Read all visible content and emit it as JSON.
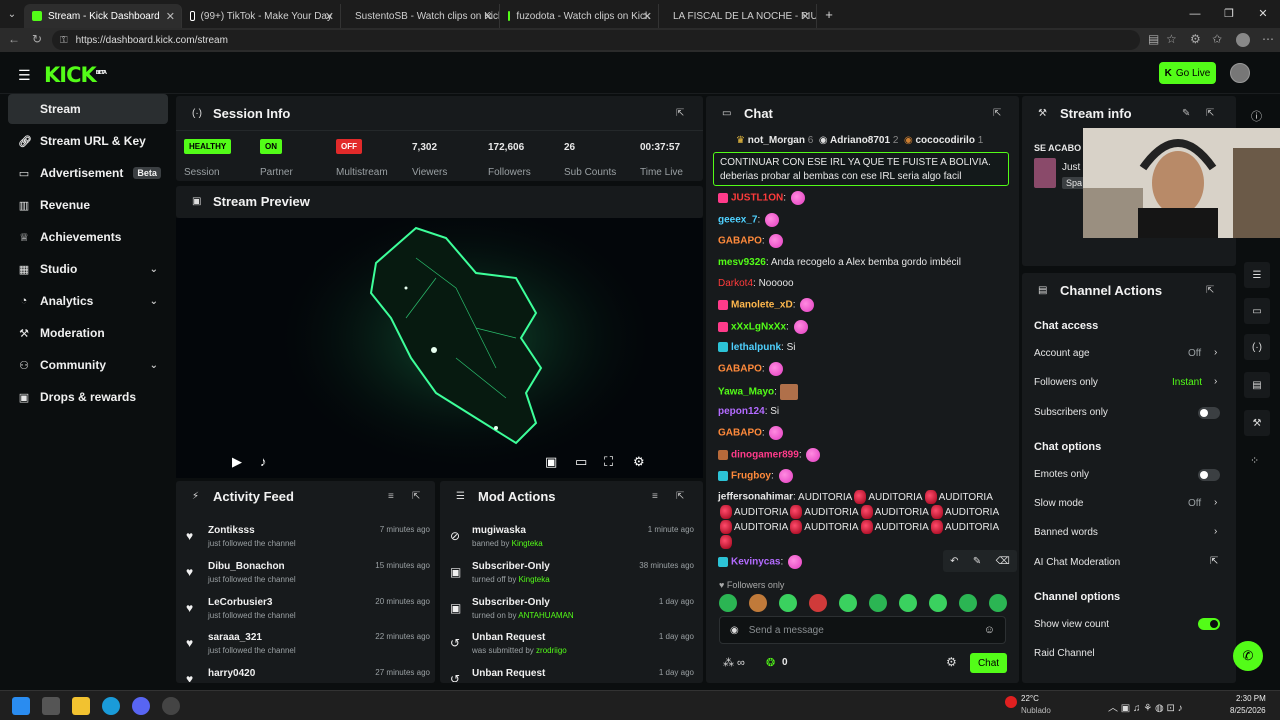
{
  "browser": {
    "tabs": [
      {
        "title": "Stream - Kick Dashboard",
        "active": true,
        "icon": "kick-icon"
      },
      {
        "title": "(99+) TikTok - Make Your Day",
        "active": false,
        "icon": "tiktok-icon"
      },
      {
        "title": "SustentoSB - Watch clips on Kick",
        "active": false,
        "icon": "kick-icon"
      },
      {
        "title": "fuzodota - Watch clips on Kick",
        "active": false,
        "icon": "kick-icon"
      },
      {
        "title": "LA FISCAL DE LA NOCHE - PIURA",
        "active": false,
        "icon": "youtube-icon"
      }
    ],
    "url": "https://dashboard.kick.com/stream"
  },
  "header": {
    "logo": "KICK",
    "logo_sup": "BETA",
    "go_live": "Go Live"
  },
  "sidebar": {
    "items": [
      {
        "label": "Stream",
        "icon": "broadcast-icon"
      },
      {
        "label": "Stream URL & Key",
        "icon": "link-icon"
      },
      {
        "label": "Advertisement",
        "badge": "Beta",
        "icon": "tv-icon"
      },
      {
        "label": "Revenue",
        "icon": "chart-icon"
      },
      {
        "label": "Achievements",
        "icon": "trophy-icon"
      },
      {
        "label": "Studio",
        "icon": "grid-icon"
      },
      {
        "label": "Analytics",
        "icon": "analytics-icon"
      },
      {
        "label": "Moderation",
        "icon": "wrench-icon"
      },
      {
        "label": "Community",
        "icon": "users-icon"
      },
      {
        "label": "Drops & rewards",
        "icon": "gift-icon"
      }
    ]
  },
  "session": {
    "title": "Session Info",
    "healthy": "HEALTHY",
    "session_label": "Session",
    "partner_badge": "ON",
    "partner_label": "Partner",
    "multistream_badge": "OFF",
    "multistream_label": "Multistream",
    "viewers": "7,302",
    "viewers_label": "Viewers",
    "followers": "172,606",
    "followers_label": "Followers",
    "subs": "26",
    "subs_label": "Sub Counts",
    "time": "00:37:57",
    "time_label": "Time Live"
  },
  "preview": {
    "title": "Stream Preview"
  },
  "activity": {
    "title": "Activity Feed",
    "items": [
      {
        "name": "Zontiksss",
        "sub": "just followed the channel",
        "time": "7 minutes ago"
      },
      {
        "name": "Dibu_Bonachon",
        "sub": "just followed the channel",
        "time": "15 minutes ago"
      },
      {
        "name": "LeCorbusier3",
        "sub": "just followed the channel",
        "time": "20 minutes ago"
      },
      {
        "name": "saraaa_321",
        "sub": "just followed the channel",
        "time": "22 minutes ago"
      },
      {
        "name": "harry0420",
        "sub": "",
        "time": "27 minutes ago"
      }
    ]
  },
  "mod": {
    "title": "Mod Actions",
    "items": [
      {
        "name": "mugiwaska",
        "sub": "banned by",
        "by": "Kingteka",
        "time": "1 minute ago"
      },
      {
        "name": "Subscriber-Only",
        "sub": "turned off by",
        "by": "Kingteka",
        "time": "38 minutes ago"
      },
      {
        "name": "Subscriber-Only",
        "sub": "turned on by",
        "by": "ANTAHUAMAN",
        "time": "1 day ago"
      },
      {
        "name": "Unban Request",
        "sub": "was submitted by",
        "by": "zrodriigo",
        "time": "1 day ago"
      },
      {
        "name": "Unban Request",
        "sub": "",
        "by": "",
        "time": "1 day ago"
      }
    ]
  },
  "chat": {
    "title": "Chat",
    "top_gifters": [
      {
        "name": "not_Morgan",
        "count": "6"
      },
      {
        "name": "Adriano8701",
        "count": "2"
      },
      {
        "name": "cococodirilo",
        "count": "1"
      }
    ],
    "pinned": "CONTINUAR CON ESE IRL YA QUE TE FUISTE A BOLIVIA. deberias probar al bembas con ese IRL seria algo facil",
    "messages": [
      {
        "user": "JUSTL1ON",
        "color": "#ff3b3b",
        "text": ""
      },
      {
        "user": "geeex_7",
        "color": "#4fd1ff",
        "text": ""
      },
      {
        "user": "GABAPO",
        "color": "#ff8a3b",
        "text": ""
      },
      {
        "user": "mesv9326",
        "color": "#53fc18",
        "text": "Anda recogelo a Alex bemba gordo imbécil"
      },
      {
        "user": "Darkot4",
        "color": "#ff3b3b",
        "text": "Nooooo"
      },
      {
        "user": "Manolete_xD",
        "color": "#ffb84d",
        "text": ""
      },
      {
        "user": "xXxLgNxXx",
        "color": "#53fc18",
        "text": ""
      },
      {
        "user": "lethalpunk",
        "color": "#4fd1ff",
        "text": "Si"
      },
      {
        "user": "GABAPO",
        "color": "#ff8a3b",
        "text": ""
      },
      {
        "user": "Yawa_Mayo",
        "color": "#53fc18",
        "text": ""
      },
      {
        "user": "pepon124",
        "color": "#b36bff",
        "text": "Si"
      },
      {
        "user": "GABAPO",
        "color": "#ff8a3b",
        "text": ""
      },
      {
        "user": "dinogamer899",
        "color": "#ff3b8a",
        "text": ""
      },
      {
        "user": "Frugboy",
        "color": "#ff8a3b",
        "text": ""
      }
    ],
    "spam_user": "jeffersonahimar",
    "spam_word": "AUDITORIA",
    "last_user": "Kevinycas",
    "followers_only": "Followers only",
    "input_placeholder": "Send a message",
    "points": "0",
    "send": "Chat"
  },
  "stream_info": {
    "title": "Stream info",
    "preview_text": "SE ACABO",
    "just": "Just",
    "spa": "Spa"
  },
  "channel": {
    "title": "Channel Actions",
    "chat_access": "Chat access",
    "account_age": "Account age",
    "account_age_val": "Off",
    "followers_only": "Followers only",
    "followers_only_val": "Instant",
    "subscribers_only": "Subscribers only",
    "chat_options": "Chat options",
    "emotes_only": "Emotes only",
    "slow_mode": "Slow mode",
    "slow_mode_val": "Off",
    "banned_words": "Banned words",
    "ai_mod": "AI Chat Moderation",
    "channel_options": "Channel options",
    "show_view_count": "Show view count",
    "raid": "Raid Channel"
  },
  "taskbar": {
    "temp": "22°C",
    "weather": "Nublado",
    "time": "2:30 PM",
    "date": "8/25/2026"
  }
}
